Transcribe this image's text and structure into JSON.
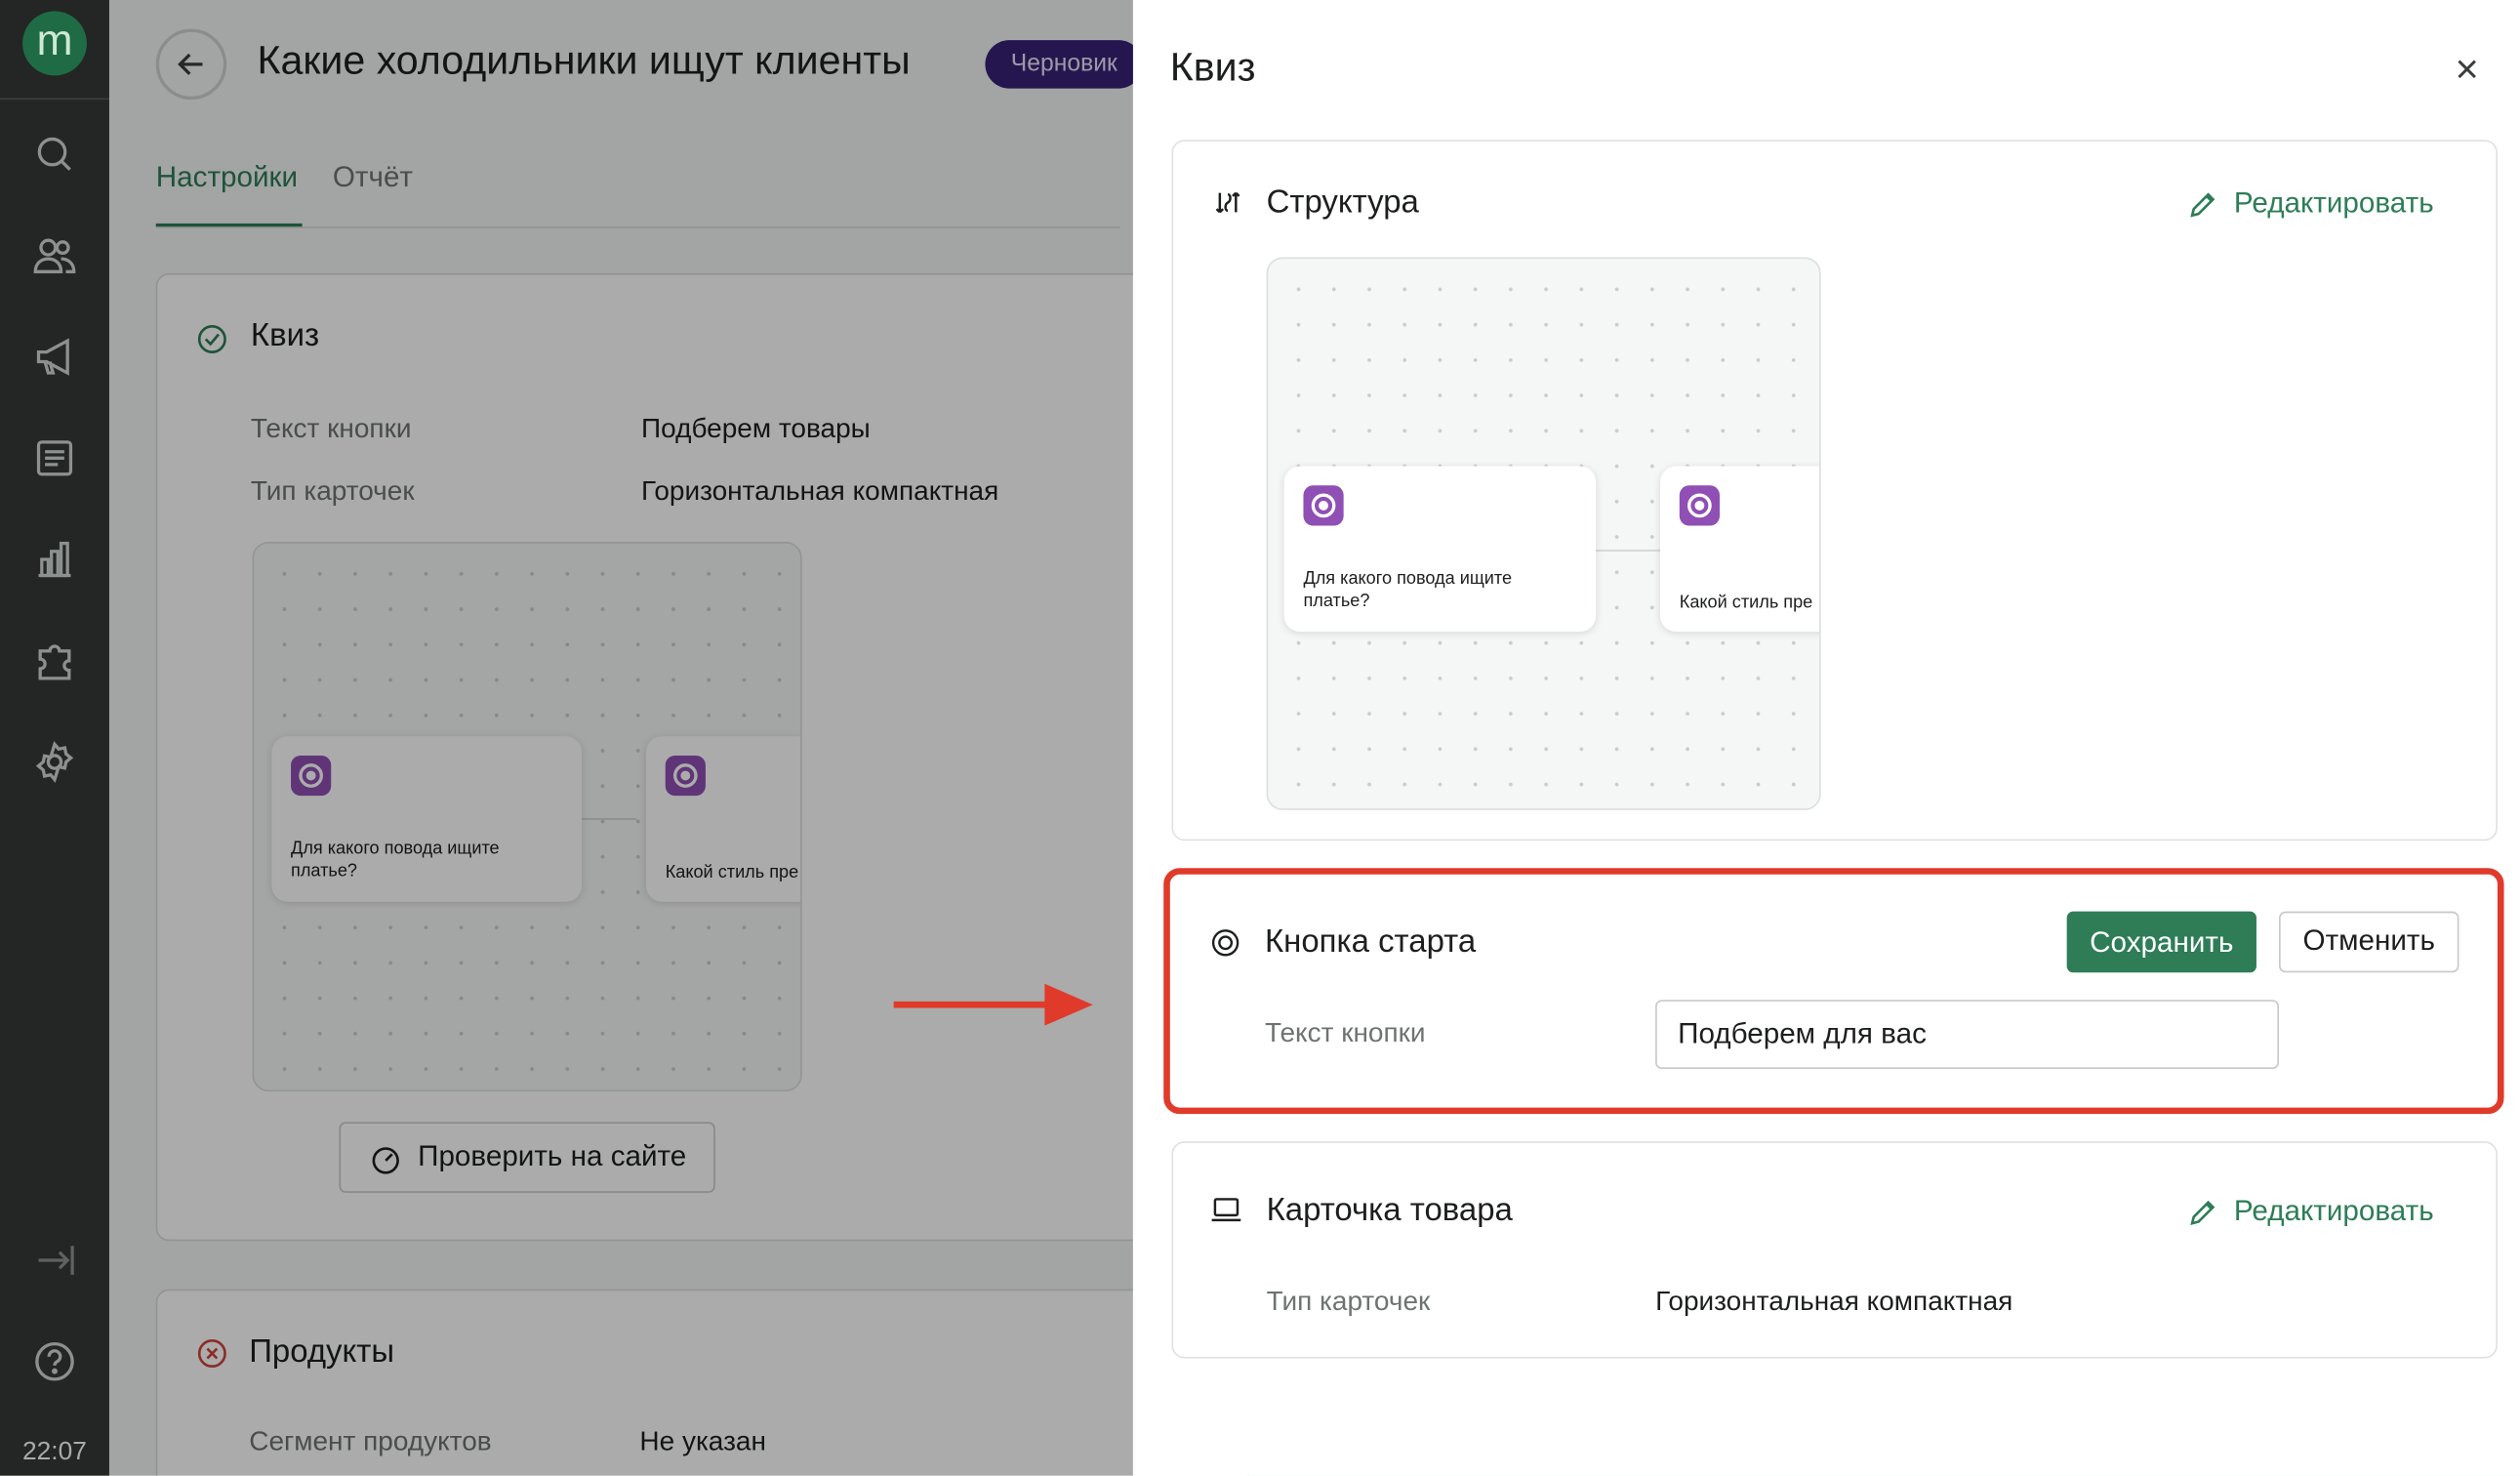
{
  "rail": {
    "logo": "m",
    "time": "22:07",
    "icons": [
      "search-icon",
      "users-icon",
      "megaphone-icon",
      "list-icon",
      "chart-icon",
      "puzzle-icon",
      "gear-icon",
      "logout-icon",
      "help-icon"
    ]
  },
  "header": {
    "title": "Какие холодильники ищут клиенты",
    "status": "Черновик"
  },
  "tabs": [
    "Настройки",
    "Отчёт"
  ],
  "quiz_card": {
    "title": "Квиз",
    "button_text_label": "Текст кнопки",
    "button_text_value": "Подберем товары",
    "card_type_label": "Тип карточек",
    "card_type_value": "Горизонтальная компактная",
    "check_button": "Проверить на сайте"
  },
  "preview": {
    "q1": "Для какого повода ищите платье?",
    "q2": "Какой стиль пре"
  },
  "products_card": {
    "title": "Продукты",
    "segment_label": "Сегмент продуктов",
    "segment_value": "Не указан"
  },
  "drawer": {
    "title": "Квиз",
    "structure": {
      "title": "Структура",
      "edit": "Редактировать"
    },
    "start_button": {
      "title": "Кнопка старта",
      "save": "Сохранить",
      "cancel": "Отменить",
      "field_label": "Текст кнопки",
      "field_value": "Подберем для вас"
    },
    "product_card": {
      "title": "Карточка товара",
      "edit": "Редактировать",
      "type_label": "Тип карточек",
      "type_value": "Горизонтальная компактная"
    }
  },
  "colors": {
    "accent": "#2e7d57",
    "badge": "#3a2277",
    "highlight": "#e03a2b",
    "quiz_icon": "#8f4fb4"
  }
}
